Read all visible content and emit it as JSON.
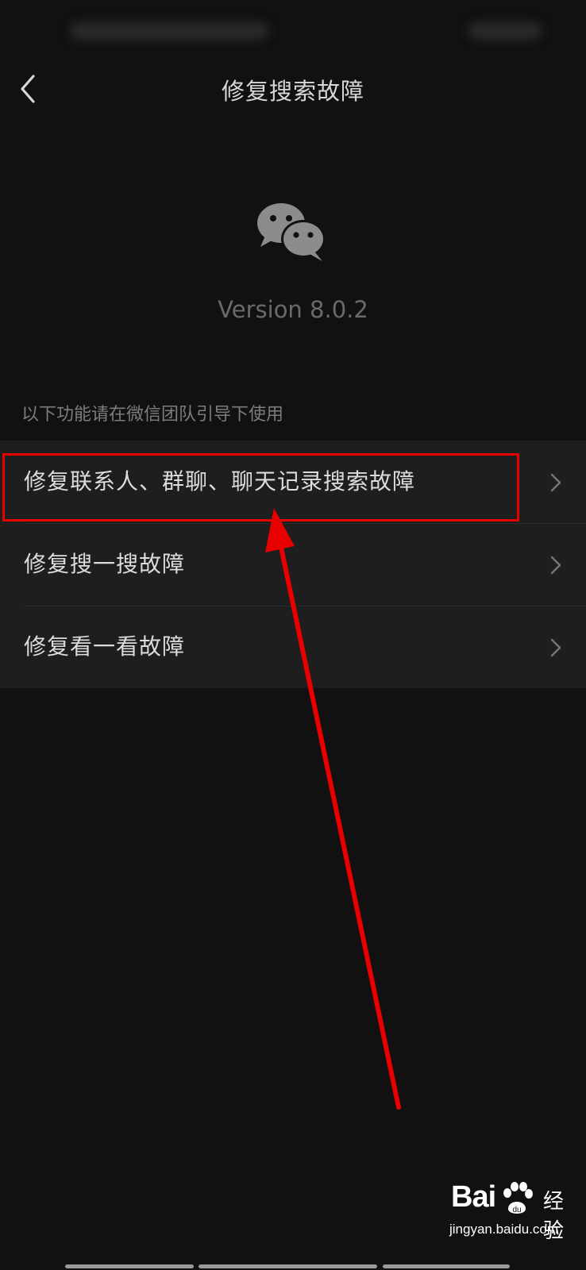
{
  "nav": {
    "title": "修复搜索故障",
    "back_icon": "chevron-left-icon"
  },
  "app": {
    "logo_icon": "wechat-logo-icon",
    "version": "Version 8.0.2"
  },
  "section": {
    "hint": "以下功能请在微信团队引导下使用"
  },
  "menu": {
    "items": [
      {
        "label": "修复联系人、群聊、聊天记录搜索故障",
        "icon": "chevron-right-icon",
        "highlighted": true
      },
      {
        "label": "修复搜一搜故障",
        "icon": "chevron-right-icon"
      },
      {
        "label": "修复看一看故障",
        "icon": "chevron-right-icon"
      }
    ]
  },
  "annotation": {
    "highlight_color": "#e60000",
    "arrow_color": "#e60000"
  },
  "watermark": {
    "brand": "Bai",
    "brand_suffix": "du",
    "product": "经验",
    "url": "jingyan.baidu.com"
  },
  "colors": {
    "background": "#111111",
    "list_background": "#1e1e1e",
    "text": "#dcdcdc",
    "muted": "#7c7c7c"
  }
}
